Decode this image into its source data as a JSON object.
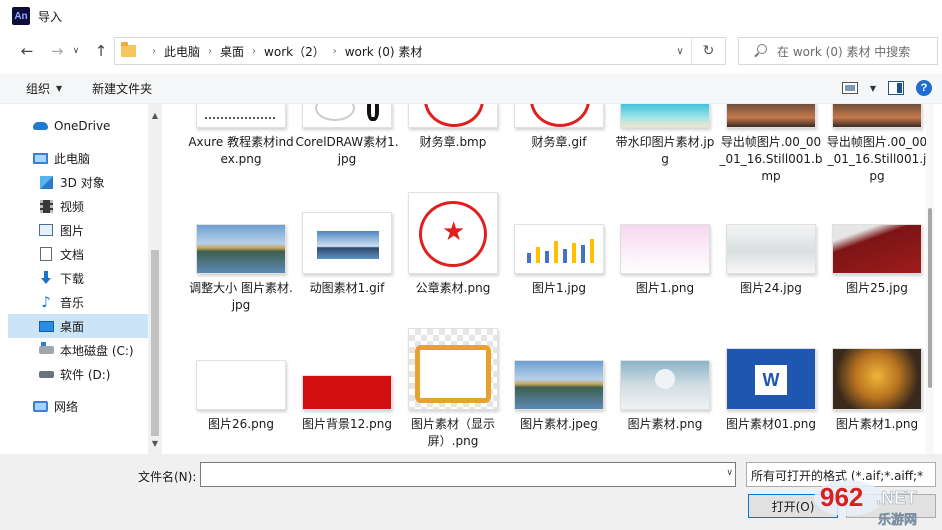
{
  "window": {
    "app_badge": "An",
    "title": "导入"
  },
  "nav": {
    "back": "←",
    "forward": "→",
    "dropdown": "∨",
    "up": "↑"
  },
  "address": {
    "crumbs": [
      "此电脑",
      "桌面",
      "work（2）",
      "work (0) 素材"
    ],
    "separator": "›",
    "refresh": "↻",
    "dropdown": "∨"
  },
  "search": {
    "placeholder": "在 work (0) 素材 中搜索"
  },
  "toolbar": {
    "organize": "组织",
    "new_folder": "新建文件夹",
    "help": "?"
  },
  "sidebar": {
    "items": [
      {
        "label": "OneDrive",
        "icon": "cloud-icon"
      },
      {
        "label": "此电脑",
        "icon": "computer-icon"
      },
      {
        "label": "3D 对象",
        "icon": "3d-objects-icon"
      },
      {
        "label": "视频",
        "icon": "video-icon"
      },
      {
        "label": "图片",
        "icon": "pictures-icon"
      },
      {
        "label": "文档",
        "icon": "documents-icon"
      },
      {
        "label": "下载",
        "icon": "downloads-icon"
      },
      {
        "label": "音乐",
        "icon": "music-icon"
      },
      {
        "label": "桌面",
        "icon": "desktop-icon",
        "selected": true
      },
      {
        "label": "本地磁盘 (C:)",
        "icon": "local-disk-icon"
      },
      {
        "label": "软件 (D:)",
        "icon": "drive-icon"
      },
      {
        "label": "网络",
        "icon": "network-icon"
      }
    ],
    "scroll_up": "▲",
    "scroll_down": "▼"
  },
  "files": [
    {
      "name": "Axure 教程素材index.png",
      "thumb": "axure"
    },
    {
      "name": "CorelDRAW素材1.jpg",
      "thumb": "corel"
    },
    {
      "name": "财务章.bmp",
      "thumb": "stamp"
    },
    {
      "name": "财务章.gif",
      "thumb": "stamp"
    },
    {
      "name": "带水印图片素材.jpg",
      "thumb": "beach"
    },
    {
      "name": "导出帧图片.00_00_01_16.Still001.bmp",
      "thumb": "sunset"
    },
    {
      "name": "导出帧图片.00_00_01_16.Still001.jpg",
      "thumb": "sunset"
    },
    {
      "name": "调整大小 图片素材.jpg",
      "thumb": "lake"
    },
    {
      "name": "动图素材1.gif",
      "thumb": "mountain"
    },
    {
      "name": "公章素材.png",
      "thumb": "seal"
    },
    {
      "name": "图片1.jpg",
      "thumb": "chart"
    },
    {
      "name": "图片1.png",
      "thumb": "pink"
    },
    {
      "name": "图片24.jpg",
      "thumb": "mist"
    },
    {
      "name": "图片25.jpg",
      "thumb": "red-roof"
    },
    {
      "name": "图片26.png",
      "thumb": "white"
    },
    {
      "name": "图片背景12.png",
      "thumb": "red"
    },
    {
      "name": "图片素材（显示屏）.png",
      "thumb": "tv"
    },
    {
      "name": "图片素材.jpeg",
      "thumb": "lake"
    },
    {
      "name": "图片素材.png",
      "thumb": "doctor"
    },
    {
      "name": "图片素材01.png",
      "thumb": "word"
    },
    {
      "name": "图片素材1.png",
      "thumb": "leaf"
    }
  ],
  "bottom": {
    "filename_label": "文件名(N):",
    "filename_value": "",
    "filter": "所有可打开的格式 (*.aif;*.aiff;*",
    "open": "打开(O)",
    "dropdown": "∨"
  },
  "watermark": {
    "logo_text": "962",
    "logo_suffix": ".NET",
    "sub_text": "乐游网"
  }
}
